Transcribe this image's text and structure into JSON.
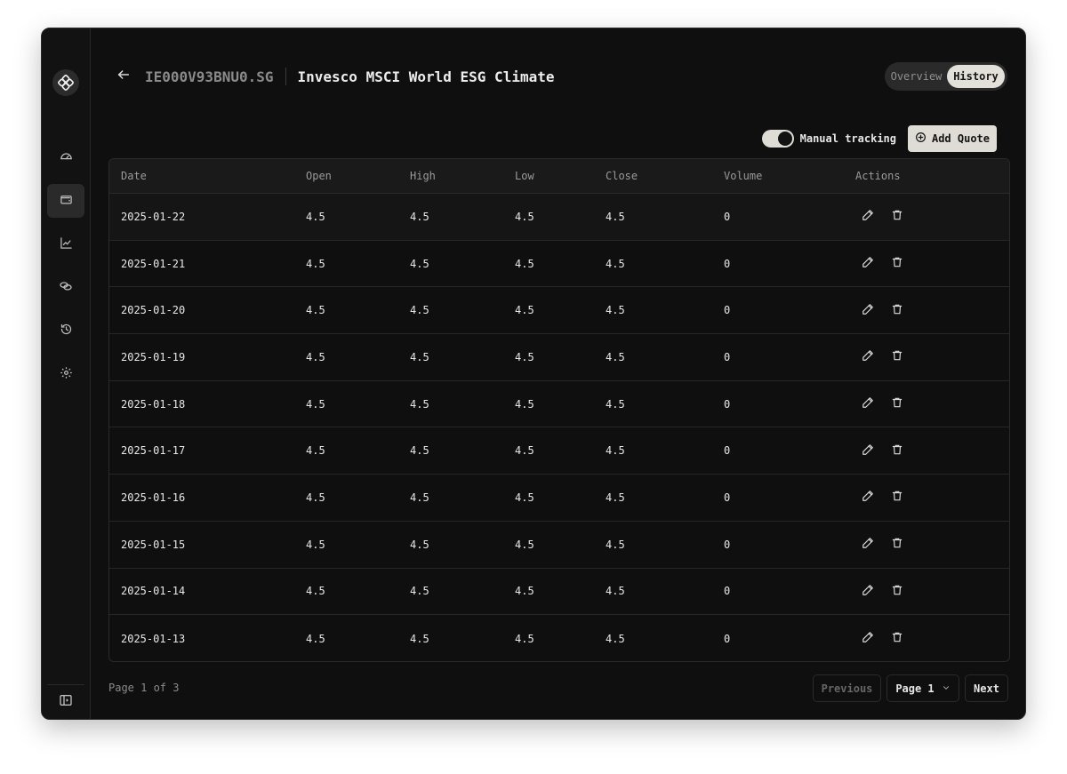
{
  "header": {
    "symbol": "IE000V93BNU0.SG",
    "title": "Invesco MSCI World ESG Climate"
  },
  "tabs": [
    {
      "label": "Overview",
      "active": false
    },
    {
      "label": "History",
      "active": true
    }
  ],
  "sidebar": {
    "items": [
      {
        "icon": "dashboard-gauge-icon"
      },
      {
        "icon": "wallet-icon",
        "active": true
      },
      {
        "icon": "chart-line-icon"
      },
      {
        "icon": "coins-icon"
      },
      {
        "icon": "history-icon"
      },
      {
        "icon": "settings-gear-icon"
      }
    ]
  },
  "controls": {
    "toggle_label": "Manual tracking",
    "toggle_on": true,
    "add_label": "Add Quote"
  },
  "table": {
    "columns": [
      "Date",
      "Open",
      "High",
      "Low",
      "Close",
      "Volume",
      "Actions"
    ],
    "rows": [
      [
        "2025-01-22",
        "4.5",
        "4.5",
        "4.5",
        "4.5",
        "0"
      ],
      [
        "2025-01-21",
        "4.5",
        "4.5",
        "4.5",
        "4.5",
        "0"
      ],
      [
        "2025-01-20",
        "4.5",
        "4.5",
        "4.5",
        "4.5",
        "0"
      ],
      [
        "2025-01-19",
        "4.5",
        "4.5",
        "4.5",
        "4.5",
        "0"
      ],
      [
        "2025-01-18",
        "4.5",
        "4.5",
        "4.5",
        "4.5",
        "0"
      ],
      [
        "2025-01-17",
        "4.5",
        "4.5",
        "4.5",
        "4.5",
        "0"
      ],
      [
        "2025-01-16",
        "4.5",
        "4.5",
        "4.5",
        "4.5",
        "0"
      ],
      [
        "2025-01-15",
        "4.5",
        "4.5",
        "4.5",
        "4.5",
        "0"
      ],
      [
        "2025-01-14",
        "4.5",
        "4.5",
        "4.5",
        "4.5",
        "0"
      ],
      [
        "2025-01-13",
        "4.5",
        "4.5",
        "4.5",
        "4.5",
        "0"
      ]
    ]
  },
  "pagination": {
    "summary": "Page 1 of 3",
    "previous": "Previous",
    "page_select": "Page 1",
    "next": "Next"
  },
  "colors": {
    "background": "#0f0f0f",
    "accent": "#dedcd4"
  }
}
